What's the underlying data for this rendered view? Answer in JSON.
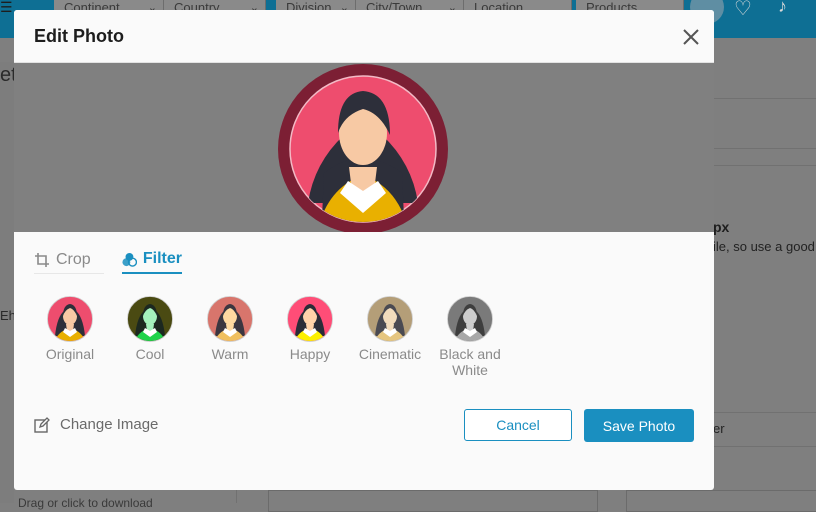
{
  "background": {
    "filters": [
      "Continent",
      "Country",
      "Division",
      "City/Town",
      "Location",
      "Products"
    ],
    "partial_texts": {
      "heading_fragment": "ett",
      "px_fragment": "px",
      "help_fragment": "ile, so use a good",
      "left_fragment": "Eh",
      "er_fragment": "er",
      "bottom_fragment": "Drag or click to download"
    }
  },
  "modal": {
    "title": "Edit Photo",
    "tabs": [
      {
        "label": "Crop",
        "icon": "crop-icon",
        "active": false
      },
      {
        "label": "Filter",
        "icon": "filter-icon",
        "active": true
      }
    ],
    "filters": [
      {
        "label": "Original",
        "bg": "#ee4d6e",
        "hair": "#2d2f3a",
        "skin": "#f7c9a4",
        "shirt": "#e9b000"
      },
      {
        "label": "Cool",
        "bg": "#4a4a12",
        "hair": "#1c2820",
        "skin": "#a4f1bc",
        "shirt": "#1ed34a"
      },
      {
        "label": "Warm",
        "bg": "#d8756c",
        "hair": "#3b3640",
        "skin": "#ffd9a0",
        "shirt": "#f0c060"
      },
      {
        "label": "Happy",
        "bg": "#ff4d77",
        "hair": "#2a2c38",
        "skin": "#ffd3aa",
        "shirt": "#fcf000"
      },
      {
        "label": "Cinematic",
        "bg": "#b49e78",
        "hair": "#4a4a52",
        "skin": "#f2dcbc",
        "shirt": "#e6c680"
      },
      {
        "label": "Black and White",
        "bg": "#7a7a7a",
        "hair": "#3e3e3e",
        "skin": "#cdcdcd",
        "shirt": "#a8a8a8"
      }
    ],
    "change_image_label": "Change Image",
    "cancel_label": "Cancel",
    "save_label": "Save Photo"
  },
  "colors": {
    "accent": "#1a8fc0",
    "avatar_ring": "#7c1f34",
    "avatar_bg": "#ee4d6e",
    "shirt": "#e9b000",
    "hair": "#2d2f3a",
    "skin": "#f7c9a4"
  }
}
